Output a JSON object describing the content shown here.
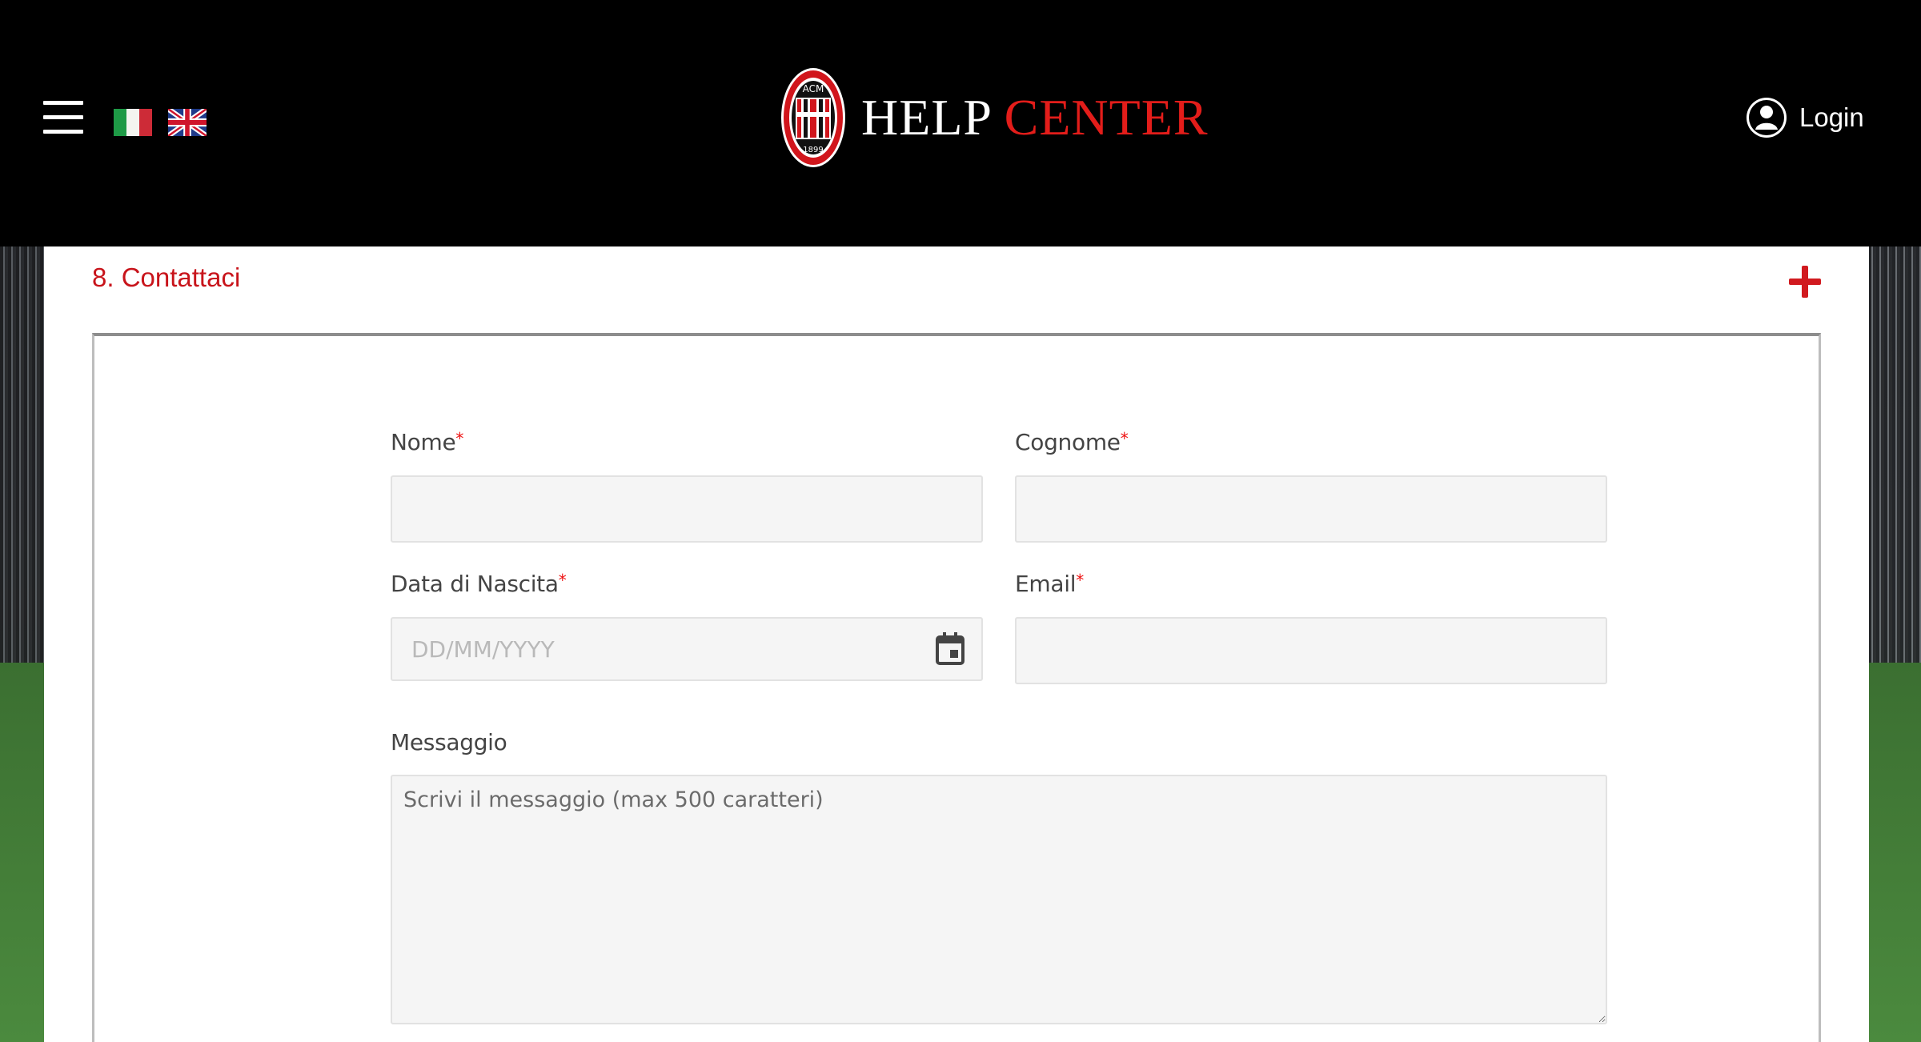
{
  "header": {
    "menu_icon": "hamburger-menu-icon",
    "languages": [
      {
        "name": "Italiano",
        "icon": "italy-flag-icon"
      },
      {
        "name": "English",
        "icon": "uk-flag-icon"
      }
    ],
    "brand": {
      "help": "HELP",
      "center": "CENTER",
      "crest_text_top": "ACM",
      "crest_text_bottom": "1899"
    },
    "login_label": "Login",
    "login_icon": "user-avatar-icon"
  },
  "section": {
    "title": "8. Contattaci",
    "toggle_icon": "plus-icon"
  },
  "form": {
    "nome": {
      "label": "Nome",
      "required_mark": "*",
      "value": ""
    },
    "cognome": {
      "label": "Cognome",
      "required_mark": "*",
      "value": ""
    },
    "data_nascita": {
      "label": "Data di Nascita",
      "required_mark": "*",
      "placeholder": "DD/MM/YYYY",
      "icon": "calendar-icon"
    },
    "email": {
      "label": "Email",
      "required_mark": "*",
      "value": ""
    },
    "messaggio": {
      "label": "Messaggio",
      "placeholder": "Scrivi il messaggio (max 500 caratteri)"
    }
  },
  "colors": {
    "brand_red": "#e31d1a",
    "section_red": "#c8141b",
    "header_bg": "#000000",
    "input_bg": "#f5f5f5"
  }
}
